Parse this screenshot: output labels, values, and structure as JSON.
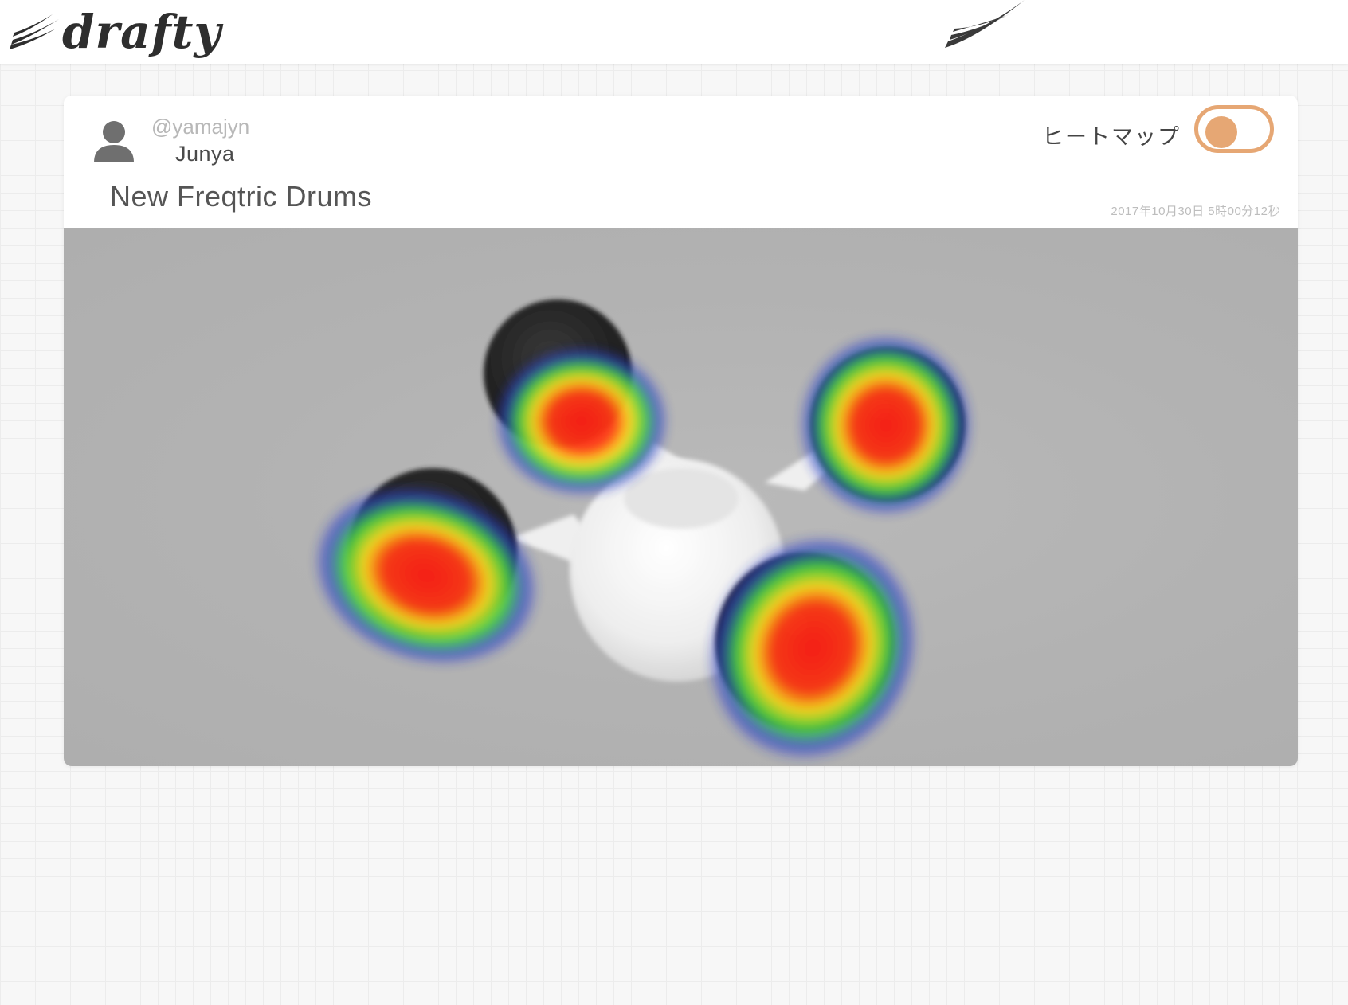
{
  "app": {
    "logo_text": "drafty",
    "logo_icon": "drafty-wing-logo",
    "center_icon": "drafty-wing-mark"
  },
  "post": {
    "user": {
      "handle": "@yamajyn",
      "display_name": "Junya",
      "avatar_icon": "user-silhouette-icon"
    },
    "title": "New Freqtric Drums",
    "timestamp": "2017年10月30日 5時00分12秒",
    "heatmap": {
      "label": "ヒートマップ",
      "enabled": true,
      "accent_color": "#e6a774"
    },
    "image": {
      "subject": "drum-product-with-heatmap-overlay",
      "heat_colors": [
        "#ff2a1a",
        "#ffe020",
        "#3cd03c",
        "#2a3acc"
      ]
    }
  }
}
